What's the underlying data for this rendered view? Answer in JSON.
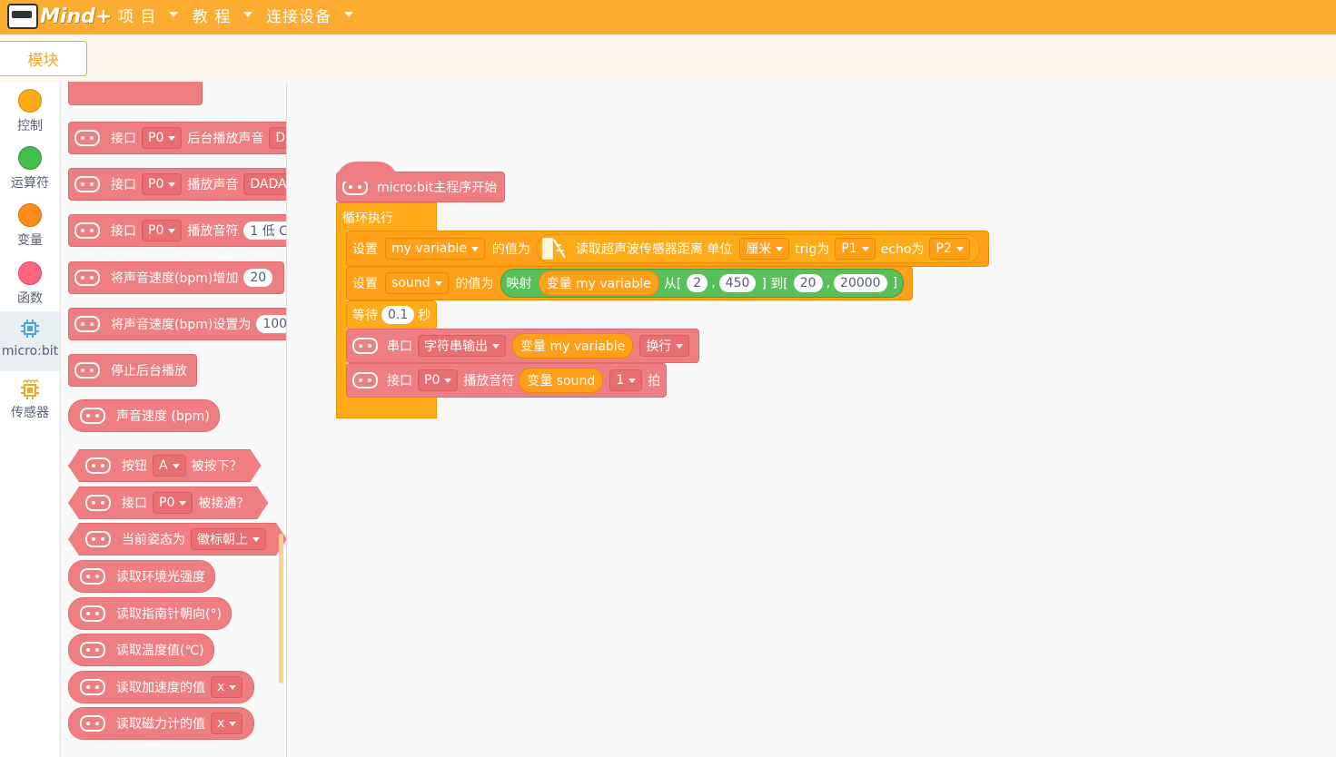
{
  "app": {
    "logo_text": "Mind+"
  },
  "menu": {
    "items": [
      "项 目",
      "教 程",
      "连接设备"
    ]
  },
  "tabs": {
    "blocks": "模块"
  },
  "categories": [
    {
      "label": "控制",
      "color": "#ffab19"
    },
    {
      "label": "运算符",
      "color": "#40bf4a"
    },
    {
      "label": "变量",
      "color": "#ff8c1a"
    },
    {
      "label": "函数",
      "color": "#ff6680"
    },
    {
      "label": "micro:bit",
      "color": "#4aa8e0"
    },
    {
      "label": "传感器",
      "color": "#f5a623"
    }
  ],
  "palette": {
    "b1": {
      "t1": "接口",
      "dd": "P0",
      "t2": "后台播放声音",
      "v": "D"
    },
    "b2": {
      "t1": "接口",
      "dd": "P0",
      "t2": "播放声音",
      "v": "DADA"
    },
    "b3": {
      "t1": "接口",
      "dd": "P0",
      "t2": "播放音符",
      "v": "1 低 C"
    },
    "b4": {
      "t1": "将声音速度(bpm)增加",
      "v": "20"
    },
    "b5": {
      "t1": "将声音速度(bpm)设置为",
      "v": "100"
    },
    "b6": {
      "t1": "停止后台播放"
    },
    "b7": {
      "t1": "声音速度 (bpm)"
    },
    "b8": {
      "t1": "按钮",
      "dd": "A",
      "t2": "被按下？"
    },
    "b9": {
      "t1": "接口",
      "dd": "P0",
      "t2": "被接通？"
    },
    "b10": {
      "t1": "当前姿态为",
      "dd": "徽标朝上"
    },
    "b11": {
      "t1": "读取环境光强度"
    },
    "b12": {
      "t1": "读取指南针朝向(°)"
    },
    "b13": {
      "t1": "读取温度值(℃)"
    },
    "b14": {
      "t1": "读取加速度的值",
      "dd": "x"
    },
    "b15": {
      "t1": "读取磁力计的值",
      "dd": "x"
    }
  },
  "script": {
    "hat": "micro:bit主程序开始",
    "loop": "循环执行",
    "set1": {
      "t1": "设置",
      "var": "my variable",
      "t2": "的值为",
      "sensor": "读取超声波传感器距离 单位",
      "unit": "厘米",
      "trig": "trig为",
      "trig_pin": "P1",
      "echo": "echo为",
      "echo_pin": "P2"
    },
    "set2": {
      "t1": "设置",
      "var": "sound",
      "t2": "的值为",
      "map": "映射",
      "var_reporter": "变量 my variable",
      "from": "从[",
      "a": "2",
      "comma": ",",
      "b": "450",
      "to": "] 到[",
      "c": "20",
      "d": "20000",
      "end": "]"
    },
    "wait": {
      "t1": "等待",
      "v": "0.1",
      "t2": "秒"
    },
    "serial": {
      "t1": "串口",
      "mode": "字符串输出",
      "var_reporter": "变量 my variable",
      "nl": "换行"
    },
    "play": {
      "t1": "接口",
      "pin": "P0",
      "t2": "播放音符",
      "var_reporter": "变量 sound",
      "beats": "1",
      "t3": "拍"
    }
  }
}
